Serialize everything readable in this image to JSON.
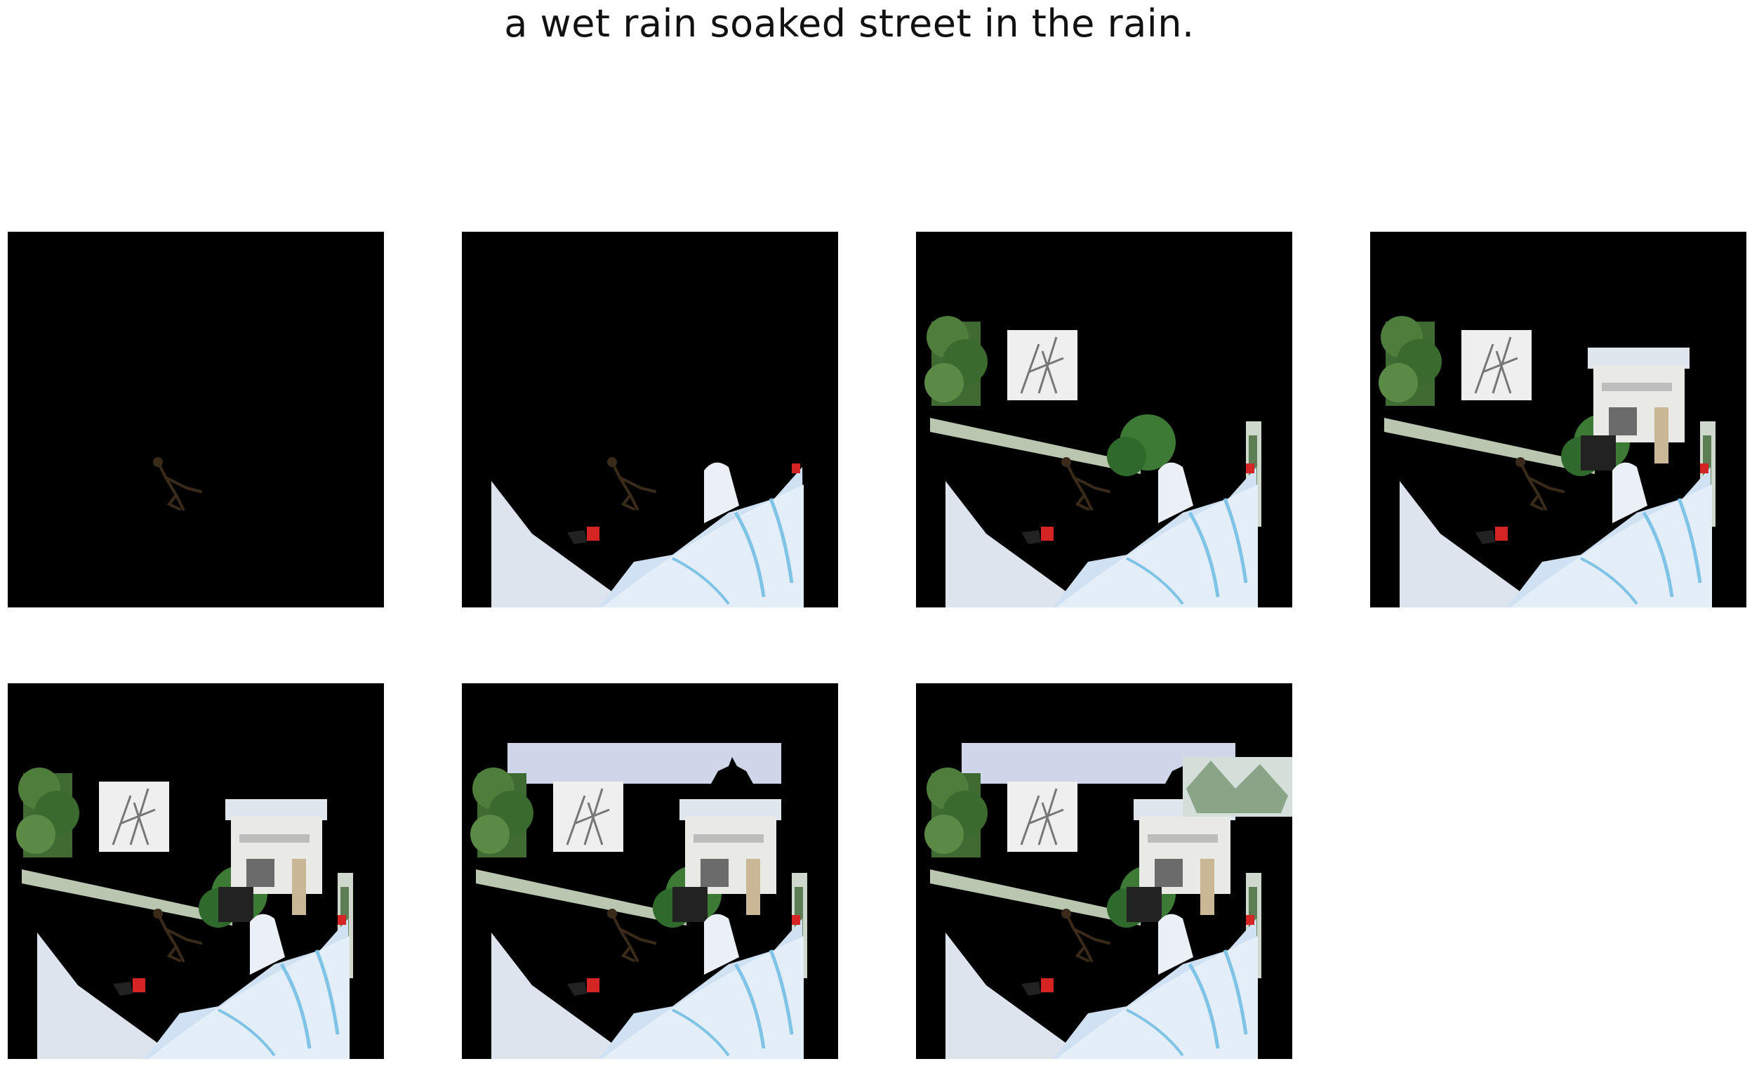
{
  "caption": "a wet rain soaked street in the rain.",
  "colors": {
    "background": "#000000",
    "snow": "#e6edf6",
    "ramp": "#cfe1f2",
    "ramp_stripe": "#7fc3e6",
    "foliage": "#3f6b33",
    "building": "#e9e9e6",
    "sky": "#cfd6ea",
    "skier": "#3a2a1a",
    "accent_red": "#d42424"
  },
  "panels": [
    {
      "index": 1,
      "stage": [
        "skier"
      ]
    },
    {
      "index": 2,
      "stage": [
        "skier",
        "ramp"
      ]
    },
    {
      "index": 3,
      "stage": [
        "skier",
        "ramp",
        "trees",
        "bush",
        "right-strip"
      ]
    },
    {
      "index": 4,
      "stage": [
        "skier",
        "ramp",
        "trees",
        "bush",
        "right-strip",
        "building"
      ]
    },
    {
      "index": 5,
      "stage": [
        "skier",
        "ramp",
        "trees",
        "bush",
        "right-strip",
        "building"
      ]
    },
    {
      "index": 6,
      "stage": [
        "skier",
        "ramp",
        "trees",
        "bush",
        "right-strip",
        "building",
        "sky"
      ]
    },
    {
      "index": 7,
      "stage": [
        "skier",
        "ramp",
        "trees",
        "bush",
        "right-strip",
        "building",
        "sky",
        "foliage-top-right"
      ]
    }
  ]
}
